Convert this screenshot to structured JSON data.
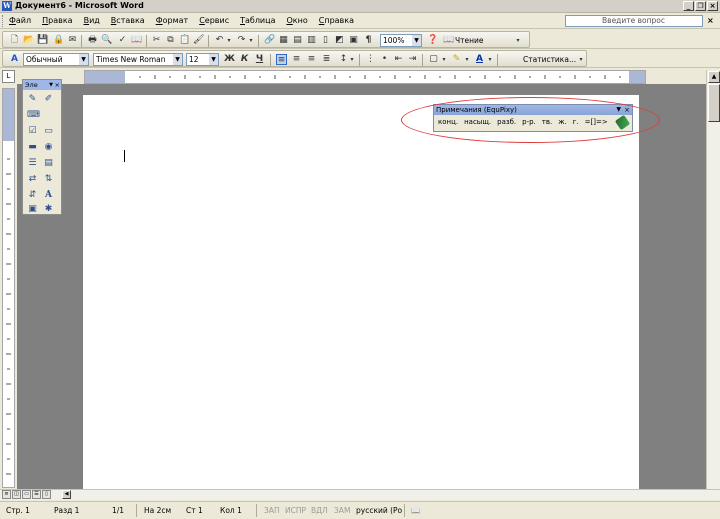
{
  "window": {
    "title": "Документ6 - Microsoft Word",
    "app_icon_letter": "W"
  },
  "menu": {
    "items": [
      "Файл",
      "Правка",
      "Вид",
      "Вставка",
      "Формат",
      "Сервис",
      "Таблица",
      "Окно",
      "Справка"
    ],
    "ask_placeholder": "Введите вопрос",
    "close": "×"
  },
  "standard_toolbar": {
    "zoom": "100%",
    "reading_label": "Чтение"
  },
  "formatting_toolbar": {
    "style": "Обычный",
    "font": "Times New Roman",
    "size": "12",
    "bold": "Ж",
    "italic": "К",
    "underline": "Ч",
    "statistics_label": "Статистика..."
  },
  "drawing_toolbar": {
    "title": "Эле"
  },
  "notes_toolbar": {
    "title": "Примечания (EquPixy)",
    "items": [
      "конц.",
      "насыщ.",
      "разб.",
      "р-р.",
      "тв.",
      "ж.",
      "г.",
      "=[]=>"
    ]
  },
  "status": {
    "page": "Стр. 1",
    "section": "Разд 1",
    "pages": "1/1",
    "at": "На 2см",
    "line": "Ст 1",
    "col": "Кол 1",
    "rec": "ЗАП",
    "trk": "ИСПР",
    "ext": "ВДЛ",
    "ovr": "ЗАМ",
    "language": "русский (Ро"
  }
}
